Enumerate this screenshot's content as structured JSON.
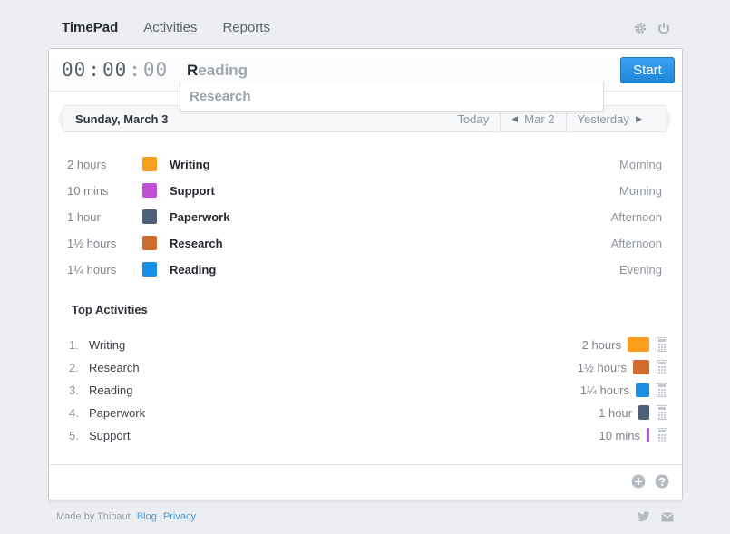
{
  "app": {
    "brand": "TimePad",
    "nav": [
      "Activities",
      "Reports"
    ]
  },
  "timer": {
    "hours": "00",
    "minutes": "00",
    "seconds": "00",
    "sep": ":"
  },
  "activity_input": {
    "typed": "R",
    "suggestion_rest": "eading",
    "value": "Reading"
  },
  "dropdown": {
    "option": "Research"
  },
  "start_label": "Start",
  "date_bar": {
    "date": "Sunday, March 3",
    "today": "Today",
    "prev": "Mar 2",
    "next": "Yesterday"
  },
  "entries": [
    {
      "duration": "2 hours",
      "name": "Writing",
      "time_of_day": "Morning",
      "color": "#f99e1c"
    },
    {
      "duration": "10 mins",
      "name": "Support",
      "time_of_day": "Morning",
      "color": "#c04fd6"
    },
    {
      "duration": "1 hour",
      "name": "Paperwork",
      "time_of_day": "Afternoon",
      "color": "#4e6076"
    },
    {
      "duration": "1½ hours",
      "name": "Research",
      "time_of_day": "Afternoon",
      "color": "#cf6c2e"
    },
    {
      "duration": "1¼ hours",
      "name": "Reading",
      "time_of_day": "Evening",
      "color": "#1a8fe6"
    }
  ],
  "top_activities": {
    "title": "Top Activities",
    "items": [
      {
        "rank": "1.",
        "name": "Writing",
        "total": "2 hours",
        "share": 1.0,
        "color": "#f99e1c"
      },
      {
        "rank": "2.",
        "name": "Research",
        "total": "1½ hours",
        "share": 0.75,
        "color": "#cf6c2e"
      },
      {
        "rank": "3.",
        "name": "Reading",
        "total": "1¼ hours",
        "share": 0.625,
        "color": "#1a8fe6"
      },
      {
        "rank": "4.",
        "name": "Paperwork",
        "total": "1 hour",
        "share": 0.5,
        "color": "#4e6076"
      },
      {
        "rank": "5.",
        "name": "Support",
        "total": "10 mins",
        "share": 0.083,
        "color": "#c04fd6"
      }
    ]
  },
  "credits": {
    "made_by": "Made by Thibaut",
    "blog": "Blog",
    "privacy": "Privacy"
  },
  "icons": {
    "settings": "gear-icon",
    "power": "power-icon",
    "add": "plus-circle-icon",
    "help": "question-circle-icon",
    "twitter": "twitter-icon",
    "mail": "mail-icon",
    "calculator": "calculator-icon"
  }
}
